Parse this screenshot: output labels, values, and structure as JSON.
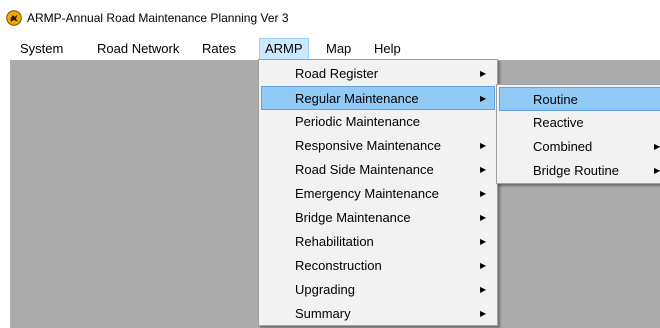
{
  "window": {
    "title": "ARMP-Annual Road Maintenance Planning Ver 3"
  },
  "menubar": {
    "items": [
      {
        "label": "System"
      },
      {
        "label": "Road Network"
      },
      {
        "label": "Rates"
      },
      {
        "label": "ARMP",
        "active": true
      },
      {
        "label": "Map"
      },
      {
        "label": "Help"
      }
    ]
  },
  "armp_menu": {
    "items": [
      {
        "label": "Road Register",
        "submenu": true
      },
      {
        "label": "Regular Maintenance",
        "submenu": true,
        "highlighted": true
      },
      {
        "label": "Periodic Maintenance",
        "submenu": false
      },
      {
        "label": "Responsive Maintenance",
        "submenu": true
      },
      {
        "label": "Road Side Maintenance",
        "submenu": true
      },
      {
        "label": "Emergency Maintenance",
        "submenu": true
      },
      {
        "label": "Bridge Maintenance",
        "submenu": true
      },
      {
        "label": "Rehabilitation",
        "submenu": true
      },
      {
        "label": "Reconstruction",
        "submenu": true
      },
      {
        "label": "Upgrading",
        "submenu": true
      },
      {
        "label": "Summary",
        "submenu": true
      }
    ]
  },
  "regular_maintenance_menu": {
    "items": [
      {
        "label": "Routine",
        "submenu": false,
        "highlighted": true
      },
      {
        "label": "Reactive",
        "submenu": false
      },
      {
        "label": "Combined",
        "submenu": true
      },
      {
        "label": "Bridge Routine",
        "submenu": true
      }
    ]
  },
  "colors": {
    "menu_highlight": "#91c9f7",
    "menubar_active": "#cce8ff",
    "client_background": "#ababab",
    "menu_background": "#f2f2f2"
  },
  "icons": {
    "app": "armp-app-icon",
    "submenu": "submenu-arrow-icon"
  }
}
